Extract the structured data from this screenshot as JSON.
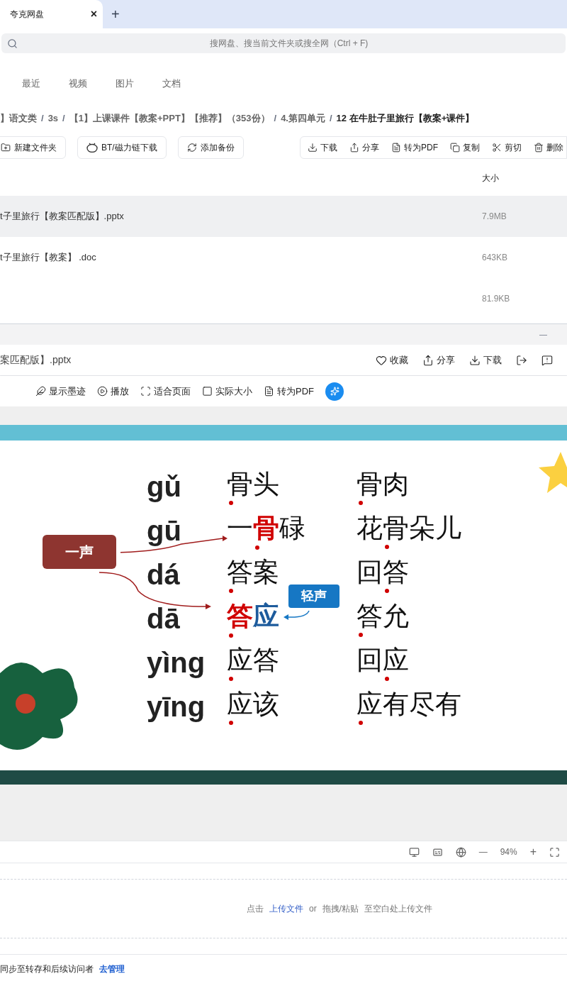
{
  "browser_tabs": [
    {
      "label": "夸克网盘",
      "selected": true,
      "close": "×"
    }
  ],
  "new_tab": "+",
  "search": {
    "placeholder": "搜网盘、搜当前文件夹或搜全网（Ctrl + F)"
  },
  "nav_tabs": [
    {
      "label": "最近",
      "selected": false
    },
    {
      "label": "视频",
      "selected": false
    },
    {
      "label": "图片",
      "selected": false
    },
    {
      "label": "文档",
      "selected": false
    }
  ],
  "breadcrumb": [
    {
      "label": "】语文类",
      "current": false
    },
    {
      "sep": "/",
      "label": "3s",
      "current": false
    },
    {
      "sep": "/",
      "label": "【1】上课课件【教案+PPT】【推荐】（353份）",
      "current": false
    },
    {
      "sep": "/",
      "label": "4.第四单元",
      "current": false
    },
    {
      "sep": "/",
      "label": "12 在牛肚子里旅行【教案+课件】",
      "current": true
    }
  ],
  "toolbar_left": [
    {
      "kind": "folder",
      "label": "新建文件夹"
    },
    {
      "kind": "bt",
      "label": "BT/磁力链下载"
    },
    {
      "kind": "backup",
      "label": "添加备份"
    }
  ],
  "toolbar_right": [
    {
      "kind": "download",
      "label": "下载"
    },
    {
      "kind": "share",
      "label": "分享"
    },
    {
      "kind": "pdf",
      "label": "转为PDF"
    },
    {
      "kind": "copy",
      "label": "复制"
    },
    {
      "kind": "cut",
      "label": "剪切"
    },
    {
      "kind": "delete",
      "label": "删除"
    }
  ],
  "table": {
    "size_header": "大小",
    "rows": [
      {
        "name": "t子里旅行【教案匹配版】.pptx",
        "size": "7.9MB",
        "selected": true
      },
      {
        "name": "t子里旅行【教案】 .doc",
        "size": "643KB",
        "selected": false
      },
      {
        "size": "81.9KB",
        "selected": false
      }
    ]
  },
  "preview": {
    "minimize": "—",
    "title": "案匹配版】.pptx",
    "actions": [
      {
        "kind": "heart",
        "label": "收藏"
      },
      {
        "kind": "share",
        "label": "分享"
      },
      {
        "kind": "download",
        "label": "下载"
      },
      {
        "kind": "exit"
      },
      {
        "kind": "report"
      }
    ],
    "tools": [
      {
        "kind": "ink",
        "label": "显示墨迹"
      },
      {
        "kind": "play",
        "label": "播放"
      },
      {
        "kind": "fit",
        "label": "适合页面"
      },
      {
        "kind": "actual",
        "label": "实际大小"
      },
      {
        "kind": "pdf",
        "label": "转为PDF"
      },
      {
        "kind": "ai"
      }
    ],
    "slide": {
      "tag": "一声",
      "note": "轻声",
      "rows": [
        {
          "pinyin": "gǔ",
          "words": [
            [
              {
                "t": "骨",
                "dot": true
              },
              {
                "t": "头"
              }
            ],
            [
              {
                "t": "骨",
                "dot": true
              },
              {
                "t": "肉"
              }
            ]
          ]
        },
        {
          "pinyin": "gū",
          "words": [
            [
              {
                "t": "一"
              },
              {
                "t": "骨",
                "dot": true,
                "color": "#d00000"
              },
              {
                "t": "碌"
              }
            ],
            [
              {
                "t": "花"
              },
              {
                "t": "骨",
                "dot": true
              },
              {
                "t": "朵"
              },
              {
                "t": "儿"
              }
            ]
          ]
        },
        {
          "pinyin": "dá",
          "words": [
            [
              {
                "t": "答",
                "dot": true
              },
              {
                "t": "案"
              }
            ],
            [
              {
                "t": "回"
              },
              {
                "t": "答",
                "dot": true
              }
            ]
          ]
        },
        {
          "pinyin": "dā",
          "words": [
            [
              {
                "t": "答",
                "dot": true,
                "color": "#d00000"
              },
              {
                "t": "应",
                "color": "#1d5b9c"
              }
            ],
            [
              {
                "t": "答",
                "dot": true
              },
              {
                "t": "允"
              }
            ]
          ]
        },
        {
          "pinyin": "yìng",
          "words": [
            [
              {
                "t": "应",
                "dot": true
              },
              {
                "t": "答"
              }
            ],
            [
              {
                "t": "回"
              },
              {
                "t": "应",
                "dot": true
              }
            ]
          ]
        },
        {
          "pinyin": "yīng",
          "words": [
            [
              {
                "t": "应",
                "dot": true
              },
              {
                "t": "该"
              }
            ],
            [
              {
                "t": "应",
                "dot": true
              },
              {
                "t": "有"
              },
              {
                "t": "尽"
              },
              {
                "t": "有"
              }
            ]
          ]
        }
      ]
    },
    "zoom": "94%",
    "zoom_minus": "—",
    "zoom_plus": "+"
  },
  "upload": [
    {
      "kind": "text",
      "text": "点击"
    },
    {
      "kind": "link",
      "text": "上传文件"
    },
    {
      "kind": "text",
      "text": "or"
    },
    {
      "kind": "text",
      "text": "拖拽/粘贴"
    },
    {
      "kind": "text",
      "text": "至空白处上传文件"
    }
  ],
  "footer": {
    "text": "同步至转存和后续访问者",
    "link": "去管理"
  }
}
